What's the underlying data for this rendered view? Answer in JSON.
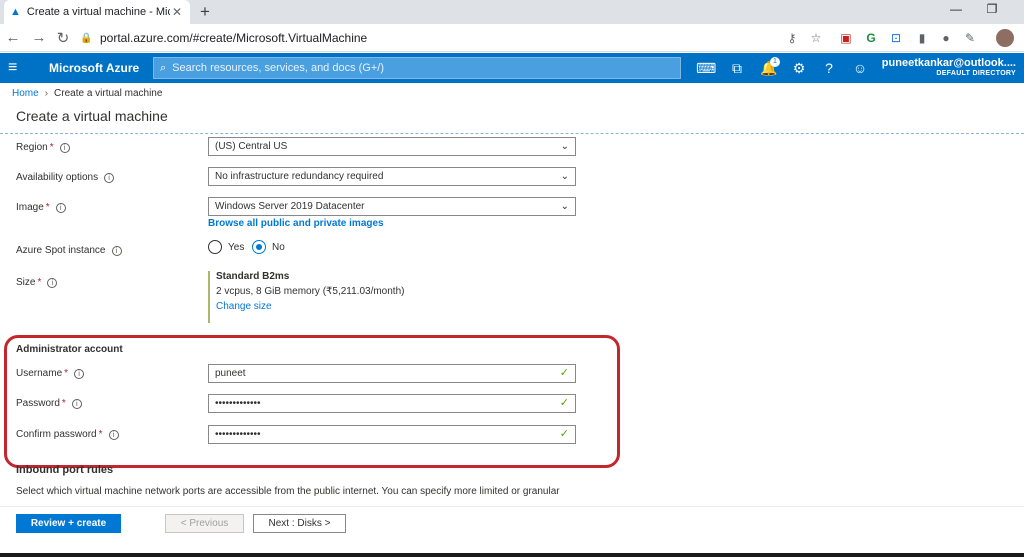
{
  "browser": {
    "tab_title": "Create a virtual machine - Micros",
    "url": "portal.azure.com/#create/Microsoft.VirtualMachine"
  },
  "header": {
    "brand": "Microsoft Azure",
    "search_placeholder": "Search resources, services, and docs (G+/)",
    "notification_count": "1",
    "account_name": "puneetkankar@outlook....",
    "account_directory": "DEFAULT DIRECTORY"
  },
  "breadcrumb": {
    "home": "Home",
    "current": "Create a virtual machine"
  },
  "page_title": "Create a virtual machine",
  "form": {
    "region": {
      "label": "Region",
      "value": "(US) Central US"
    },
    "availability": {
      "label": "Availability options",
      "value": "No infrastructure redundancy required"
    },
    "image": {
      "label": "Image",
      "value": "Windows Server 2019 Datacenter",
      "browse_link": "Browse all public and private images"
    },
    "spot": {
      "label": "Azure Spot instance",
      "yes": "Yes",
      "no": "No",
      "selected": "No"
    },
    "size": {
      "label": "Size",
      "name": "Standard B2ms",
      "specs": "2 vcpus, 8 GiB memory (₹5,211.03/month)",
      "change_link": "Change size"
    },
    "admin_section": "Administrator account",
    "username": {
      "label": "Username",
      "value": "puneet"
    },
    "password": {
      "label": "Password",
      "value": "•••••••••••••"
    },
    "confirm_password": {
      "label": "Confirm password",
      "value": "•••••••••••••"
    },
    "inbound_section": "Inbound port rules",
    "inbound_desc": "Select which virtual machine network ports are accessible from the public internet. You can specify more limited or granular"
  },
  "footer": {
    "review_create": "Review + create",
    "previous": "< Previous",
    "next": "Next : Disks >"
  },
  "colors": {
    "azure_blue": "#0072c6",
    "link_blue": "#0078d4",
    "highlight_red": "#c4262e",
    "valid_green": "#57a300"
  }
}
